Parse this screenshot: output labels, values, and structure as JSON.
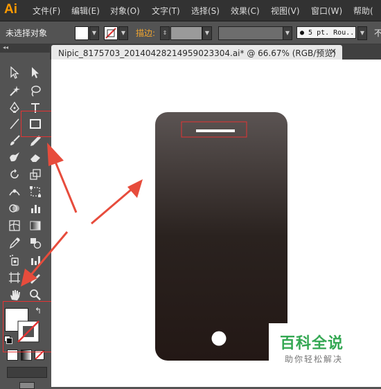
{
  "app": {
    "logo": "Ai"
  },
  "menu": [
    "文件(F)",
    "编辑(E)",
    "对象(O)",
    "文字(T)",
    "选择(S)",
    "效果(C)",
    "视图(V)",
    "窗口(W)",
    "帮助("
  ],
  "control_bar": {
    "selection_text": "未选择对象",
    "stroke_label": "描边:",
    "brush_value": "● 5 pt. Rou...",
    "opacity_label": "不"
  },
  "toolbar": {
    "collapse_glyph": "◂◂"
  },
  "document": {
    "tab_title": "Nipic_8175703_20140428214959023304.ai*  @  66.67% (RGB/预览)",
    "close_glyph": "×"
  },
  "colors": {
    "phone_top": "#5b5453",
    "phone_bottom": "#231815",
    "highlight": "#e53333",
    "arrow": "#e74c3c",
    "watermark": "#34a853"
  },
  "watermark": {
    "title": "百科全说",
    "subtitle": "助你轻松解决"
  }
}
